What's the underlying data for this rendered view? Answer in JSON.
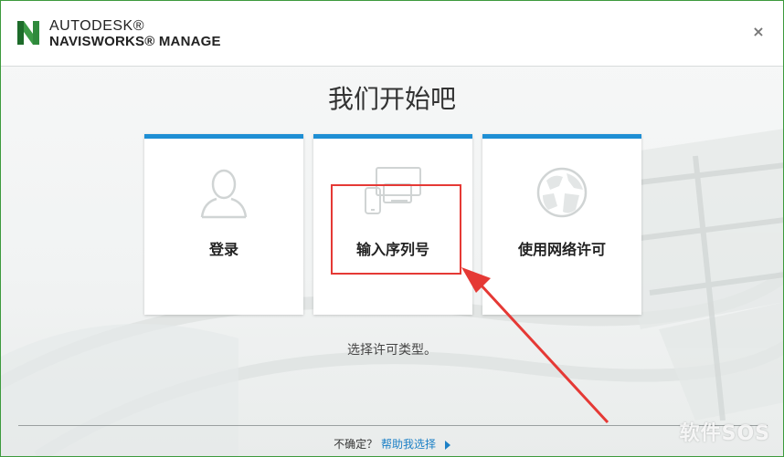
{
  "header": {
    "brand_top": "AUTODESK®",
    "brand_bottom": "NAVISWORKS® MANAGE",
    "logo_icon": "navisworks-n-logo-icon",
    "close_icon": "close-icon",
    "close_label": "×"
  },
  "main": {
    "title": "我们开始吧",
    "subtitle": "选择许可类型。",
    "cards": [
      {
        "label": "登录",
        "icon": "user-icon"
      },
      {
        "label": "输入序列号",
        "icon": "devices-icon"
      },
      {
        "label": "使用网络许可",
        "icon": "globe-icon"
      }
    ]
  },
  "footer": {
    "prompt": "不确定？",
    "help_link": "帮助我选择"
  },
  "watermark": "软件SOS",
  "colors": {
    "accent_blue": "#1e8fd4",
    "annotation_red": "#e53935",
    "brand_green": "#2f8a3c"
  }
}
